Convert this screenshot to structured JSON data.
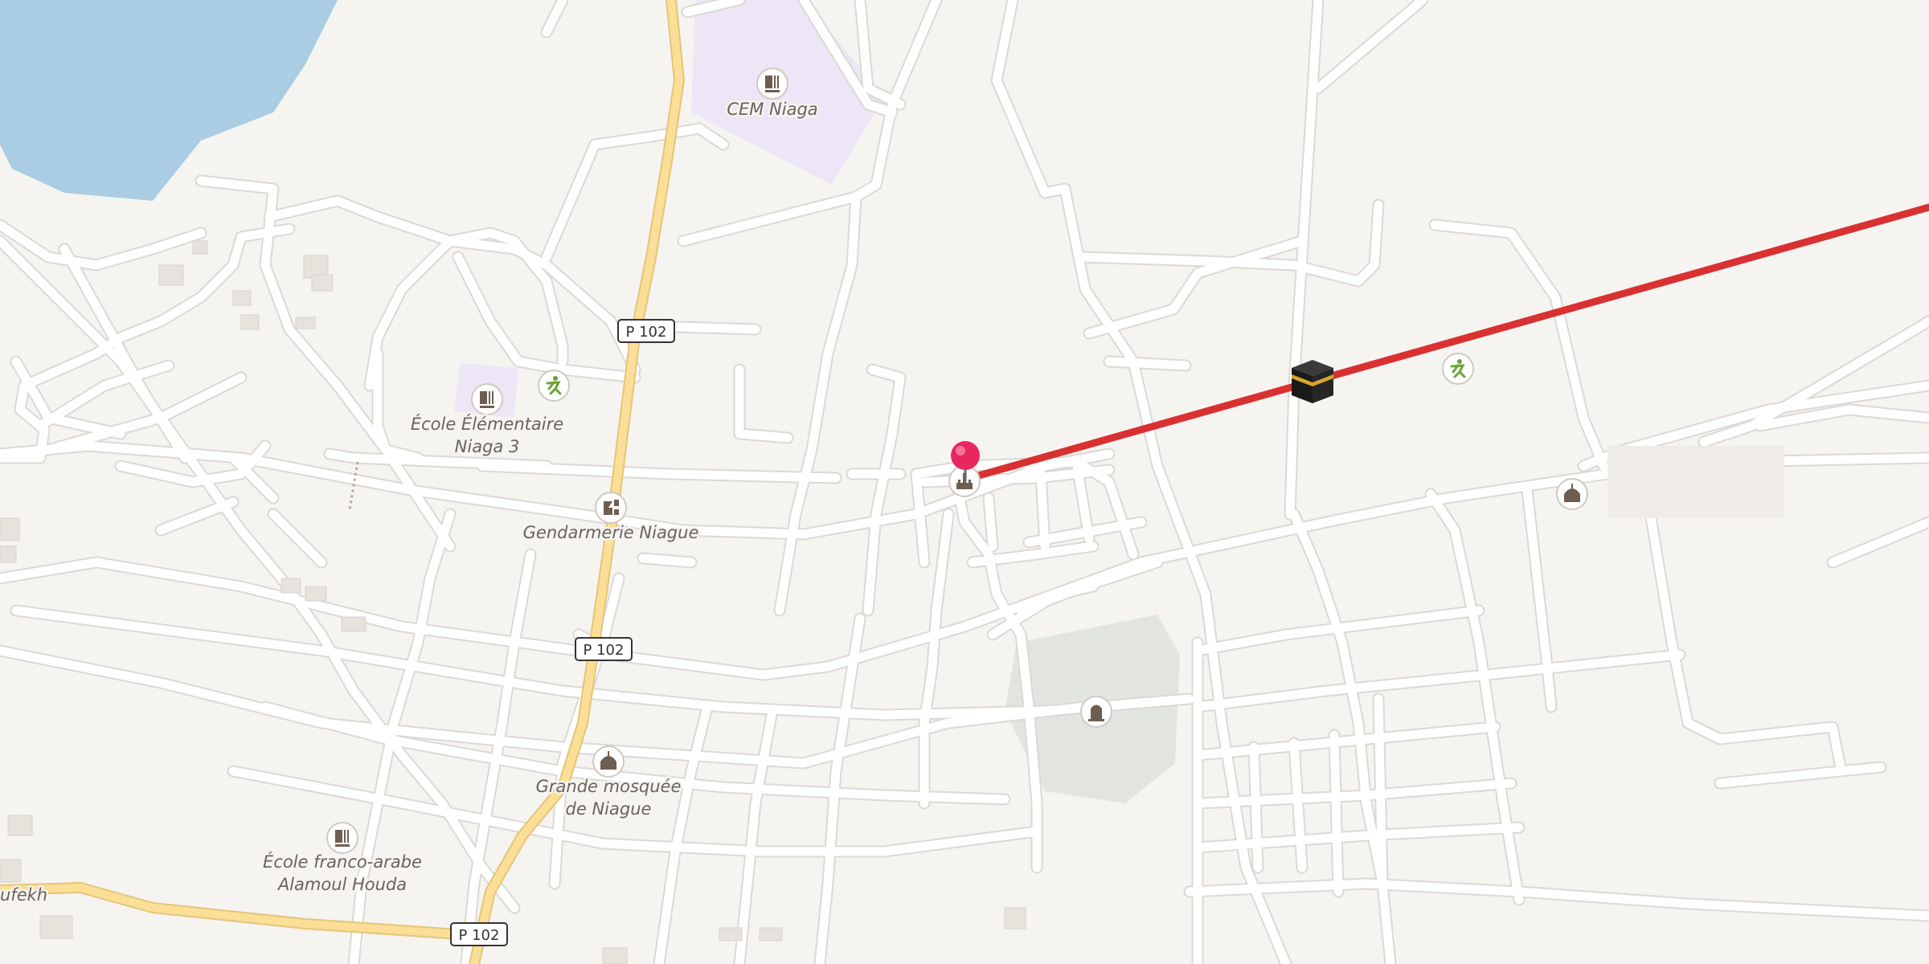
{
  "map": {
    "road_shields": [
      {
        "label": "P 102"
      },
      {
        "label": "P 102"
      },
      {
        "label": "P 102"
      }
    ],
    "places": [
      {
        "name": "CEM Niaga",
        "icon": "school-icon"
      },
      {
        "name": "École Élémentaire",
        "name2": "Niaga 3",
        "icon": "school-icon"
      },
      {
        "name": "Gendarmerie Niague",
        "icon": "police-icon"
      },
      {
        "name": "Grande mosquée",
        "name2": "de Niague",
        "icon": "mosque-icon"
      },
      {
        "name": "École franco-arabe",
        "name2": "Alamoul Houda",
        "icon": "school-icon"
      }
    ],
    "edge_label": "ufekh",
    "unlabeled_icons": [
      "sports-icon",
      "sports-icon",
      "mosque-icon",
      "cemetery-icon",
      "monument-icon"
    ],
    "route": {
      "color": "#d93131",
      "destination_icon": "kaaba-icon"
    },
    "marker": {
      "color": "#e8275f"
    },
    "colors": {
      "background": "#f6f4f1",
      "water": "#abcde3",
      "school_area": "#ece6f7",
      "cemetery_area": "#e2e5df",
      "major_road": "#fbdf96",
      "minor_road": "#ffffff"
    }
  }
}
